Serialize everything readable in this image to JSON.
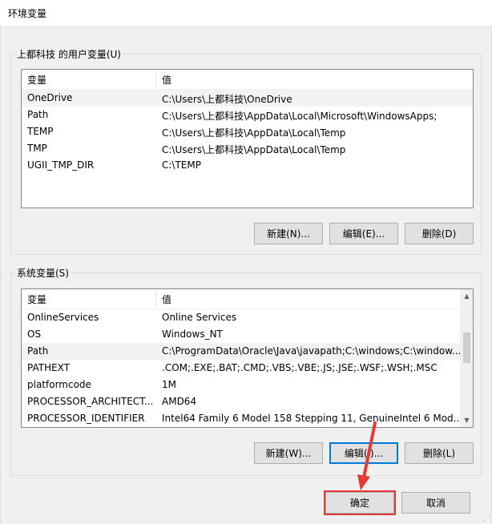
{
  "window": {
    "title": "环境变量"
  },
  "user_vars": {
    "group_label": "上都科技 的用户变量(U)",
    "columns": [
      "变量",
      "值"
    ],
    "rows": [
      {
        "name": "OneDrive",
        "value": "C:\\Users\\上都科技\\OneDrive",
        "selected": true
      },
      {
        "name": "Path",
        "value": "C:\\Users\\上都科技\\AppData\\Local\\Microsoft\\WindowsApps;",
        "selected": false
      },
      {
        "name": "TEMP",
        "value": "C:\\Users\\上都科技\\AppData\\Local\\Temp",
        "selected": false
      },
      {
        "name": "TMP",
        "value": "C:\\Users\\上都科技\\AppData\\Local\\Temp",
        "selected": false
      },
      {
        "name": "UGII_TMP_DIR",
        "value": "C:\\TEMP",
        "selected": false
      }
    ],
    "buttons": {
      "new": "新建(N)...",
      "edit": "编辑(E)...",
      "delete": "删除(D)"
    }
  },
  "system_vars": {
    "group_label": "系统变量(S)",
    "columns": [
      "变量",
      "值"
    ],
    "rows": [
      {
        "name": "OnlineServices",
        "value": "Online Services",
        "selected": false
      },
      {
        "name": "OS",
        "value": "Windows_NT",
        "selected": false
      },
      {
        "name": "Path",
        "value": "C:\\ProgramData\\Oracle\\Java\\javapath;C:\\windows;C:\\window...",
        "selected": true
      },
      {
        "name": "PATHEXT",
        "value": ".COM;.EXE;.BAT;.CMD;.VBS;.VBE;.JS;.JSE;.WSF;.WSH;.MSC",
        "selected": false
      },
      {
        "name": "platformcode",
        "value": "1M",
        "selected": false
      },
      {
        "name": "PROCESSOR_ARCHITECT...",
        "value": "AMD64",
        "selected": false
      },
      {
        "name": "PROCESSOR_IDENTIFIER",
        "value": "Intel64 Family 6 Model 158 Stepping 11, GenuineIntel 6 Mod...",
        "selected": false
      }
    ],
    "buttons": {
      "new": "新建(W)...",
      "edit": "编辑(I)...",
      "delete": "删除(L)"
    }
  },
  "footer": {
    "ok": "确定",
    "cancel": "取消"
  },
  "annotation": {
    "highlight_color": "#e53935"
  }
}
